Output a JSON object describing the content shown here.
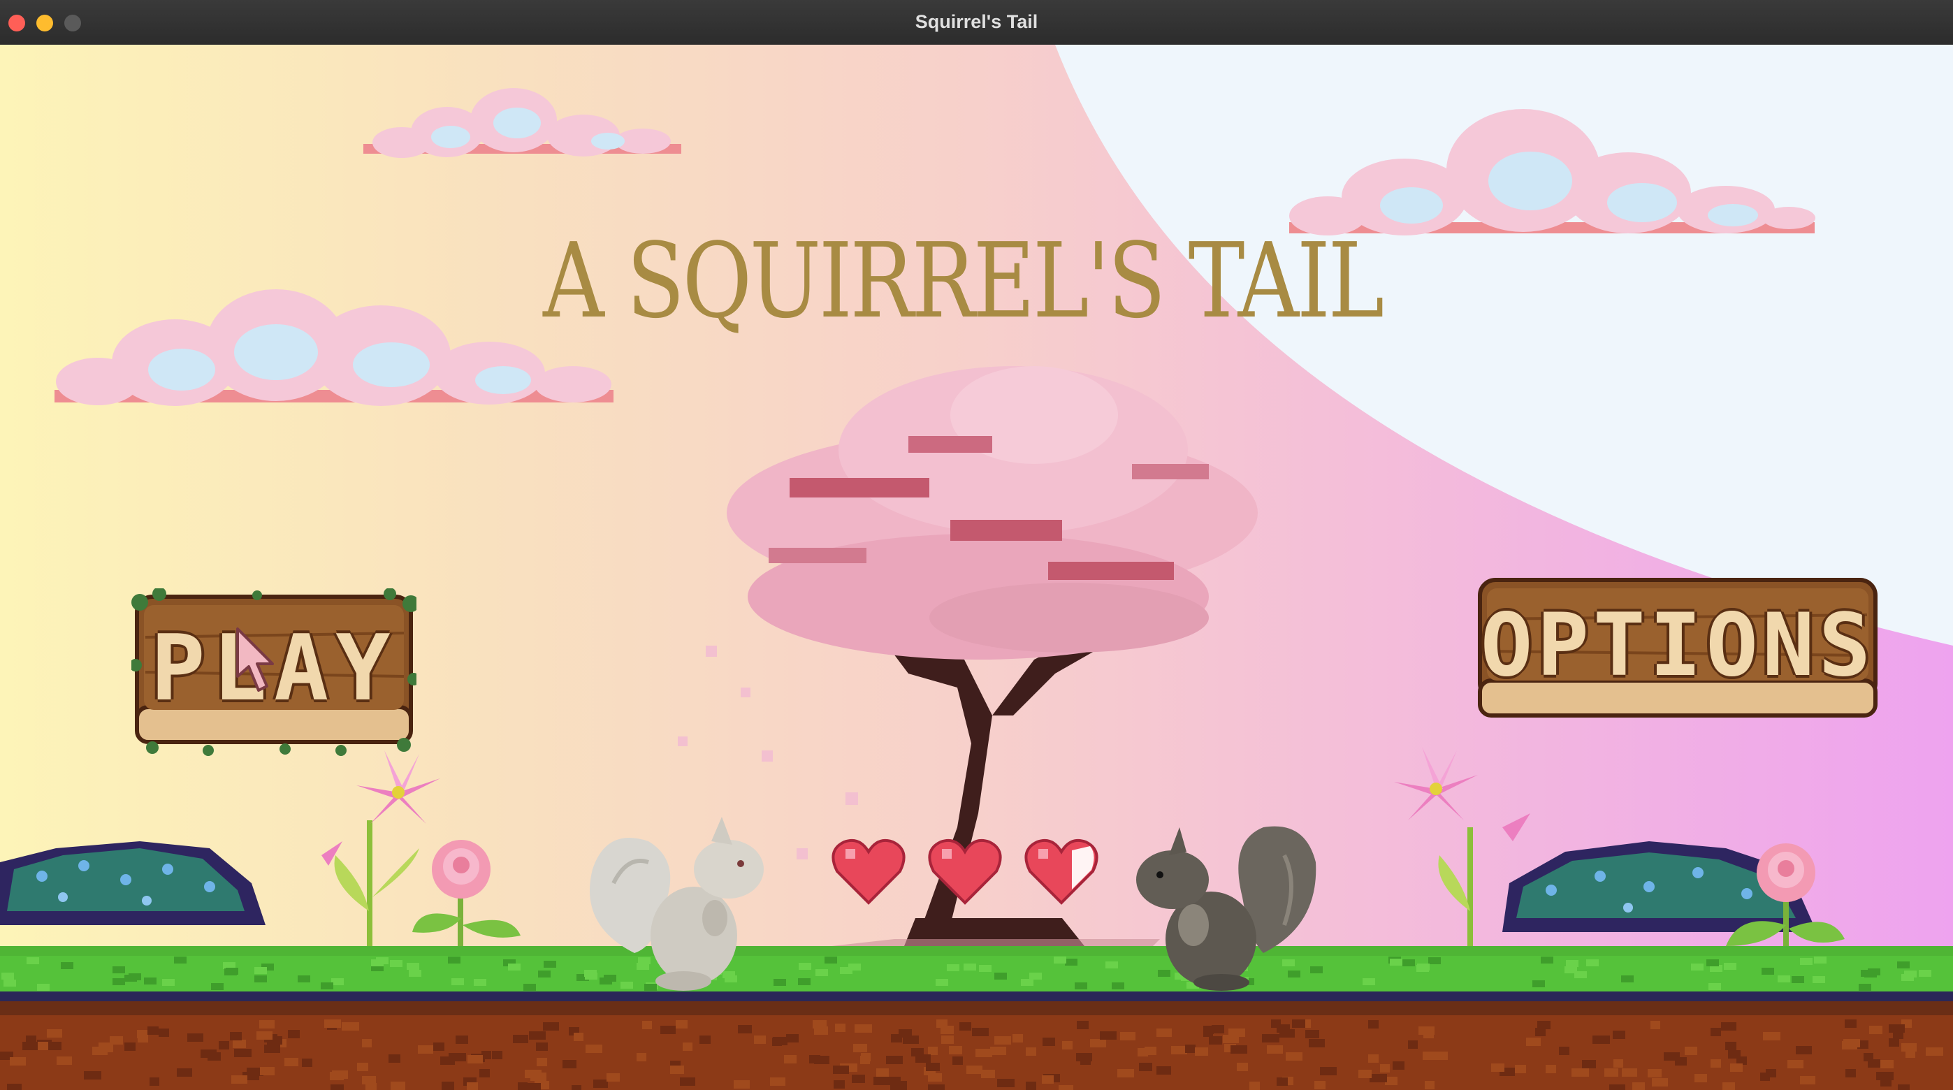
{
  "window": {
    "title": "Squirrel's Tail"
  },
  "game": {
    "title": "A SQUIRREL'S TAIL"
  },
  "menu": {
    "play_label": "PLAY",
    "options_label": "OPTIONS"
  },
  "hud": {
    "hearts_full": 2,
    "hearts_total": 3
  },
  "colors": {
    "title_gold": "#a88b43",
    "wood": "#8a5326",
    "wood_text": "#f1d8ad",
    "grass": "#55c23a",
    "dirt": "#8c3a17",
    "sakura": "#efb0c4",
    "trunk": "#3f1e1c",
    "heart": "#e8475a"
  }
}
